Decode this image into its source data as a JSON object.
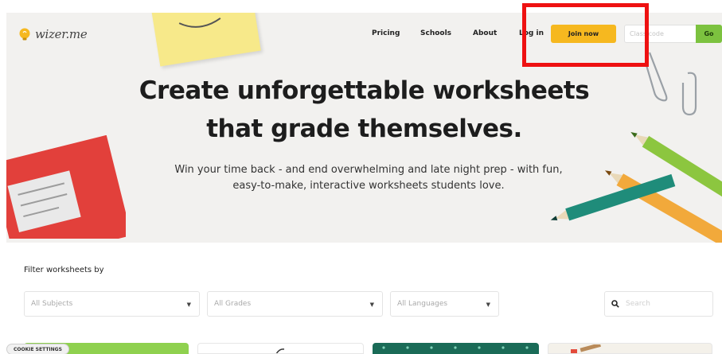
{
  "header": {
    "logo_text": "wizer.me",
    "nav": [
      "Pricing",
      "Schools",
      "About",
      "Log in"
    ],
    "join_label": "Join now",
    "class_code_placeholder": "Class code",
    "go_label": "Go"
  },
  "hero": {
    "headline_line1": "Create unforgettable worksheets",
    "headline_line2": "that grade themselves.",
    "subtitle_line1": "Win your time back - and end overwhelming and late night prep - with fun,",
    "subtitle_line2": "easy-to-make, interactive worksheets students love."
  },
  "filters": {
    "label": "Filter worksheets by",
    "subjects_placeholder": "All Subjects",
    "grades_placeholder": "All Grades",
    "languages_placeholder": "All Languages",
    "search_placeholder": "Search"
  },
  "cookie": {
    "label": "COOKIE SETTINGS"
  },
  "colors": {
    "join_button": "#f6b81f",
    "go_button": "#7cc23f",
    "highlight": "#ee1111"
  },
  "icons": {
    "logo": "lightbulb-icon",
    "search": "search-icon",
    "dropdown": "caret-down-icon"
  }
}
